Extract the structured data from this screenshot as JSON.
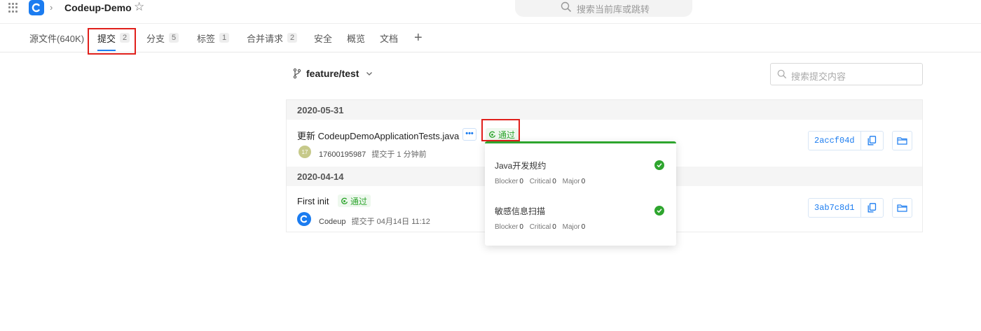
{
  "header": {
    "repo_name": "Codeup-Demo",
    "search_placeholder": "搜索当前库或跳转"
  },
  "tabs": [
    {
      "label": "源文件(640K)",
      "count": ""
    },
    {
      "label": "提交",
      "count": "2"
    },
    {
      "label": "分支",
      "count": "5"
    },
    {
      "label": "标签",
      "count": "1"
    },
    {
      "label": "合并请求",
      "count": "2"
    },
    {
      "label": "安全",
      "count": ""
    },
    {
      "label": "概览",
      "count": ""
    },
    {
      "label": "文档",
      "count": ""
    }
  ],
  "active_tab": "提交",
  "branch": {
    "name": "feature/test"
  },
  "commit_search": {
    "placeholder": "搜索提交内容"
  },
  "groups": [
    {
      "date": "2020-05-31",
      "commit": {
        "title": "更新 CodeupDemoApplicationTests.java",
        "avatar_text": "17",
        "author": "17600195987",
        "time": "提交于 1 分钟前",
        "status": "通过",
        "sha": "2accf04d"
      }
    },
    {
      "date": "2020-04-14",
      "commit": {
        "title": "First init",
        "author": "Codeup",
        "time": "提交于 04月14日 11:12",
        "status": "通过",
        "sha": "3ab7c8d1"
      }
    }
  ],
  "popup": {
    "items": [
      {
        "title": "Java开发规约",
        "blocker_label": "Blocker",
        "blocker": "0",
        "critical_label": "Critical",
        "critical": "0",
        "major_label": "Major",
        "major": "0"
      },
      {
        "title": "敏感信息扫描",
        "blocker_label": "Blocker",
        "blocker": "0",
        "critical_label": "Critical",
        "critical": "0",
        "major_label": "Major",
        "major": "0"
      }
    ]
  },
  "colors": {
    "accent": "#1b7cf0",
    "success": "#2ea52e",
    "highlight": "#e0201c"
  }
}
